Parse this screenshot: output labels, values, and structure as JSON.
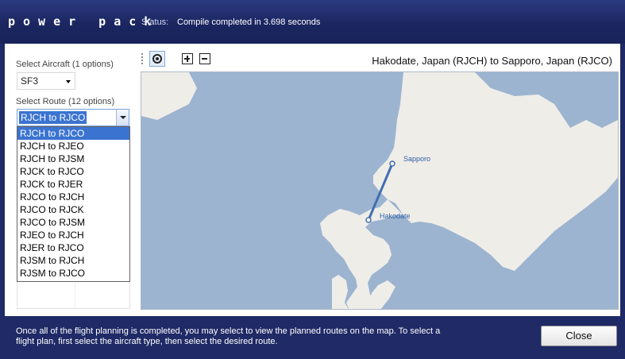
{
  "app": {
    "brand": "power pack",
    "status_label": "Status:",
    "status_text": "Compile completed in 3.698 seconds"
  },
  "aircraft": {
    "label": "Select Aircraft (1 options)",
    "selected": "SF3"
  },
  "route": {
    "label": "Select Route (12 options)",
    "selected": "RJCH to RJCO",
    "options": [
      "RJCH to RJCO",
      "RJCH to RJEO",
      "RJCH to RJSM",
      "RJCK to RJCO",
      "RJCK to RJER",
      "RJCO to RJCH",
      "RJCO to RJCK",
      "RJCO to RJSM",
      "RJEO to RJCH",
      "RJER to RJCO",
      "RJSM to RJCH",
      "RJSM to RJCO"
    ]
  },
  "map": {
    "title": "Hakodate, Japan (RJCH) to Sapporo, Japan (RJCO)",
    "cities": {
      "origin": "Hakodate",
      "destination": "Sapporo"
    },
    "colors": {
      "water": "#9cb4d0",
      "land": "#efede8",
      "route": "#3f6fb0"
    },
    "toolbar_icons": [
      "recenter-icon",
      "zoom-in-icon",
      "zoom-out-icon"
    ]
  },
  "footer": {
    "instructions": "Once all of the flight planning is completed, you may select to view the planned routes on the map.  To select a flight plan, first select the aircraft type, then select the desired route.",
    "close_label": "Close"
  }
}
